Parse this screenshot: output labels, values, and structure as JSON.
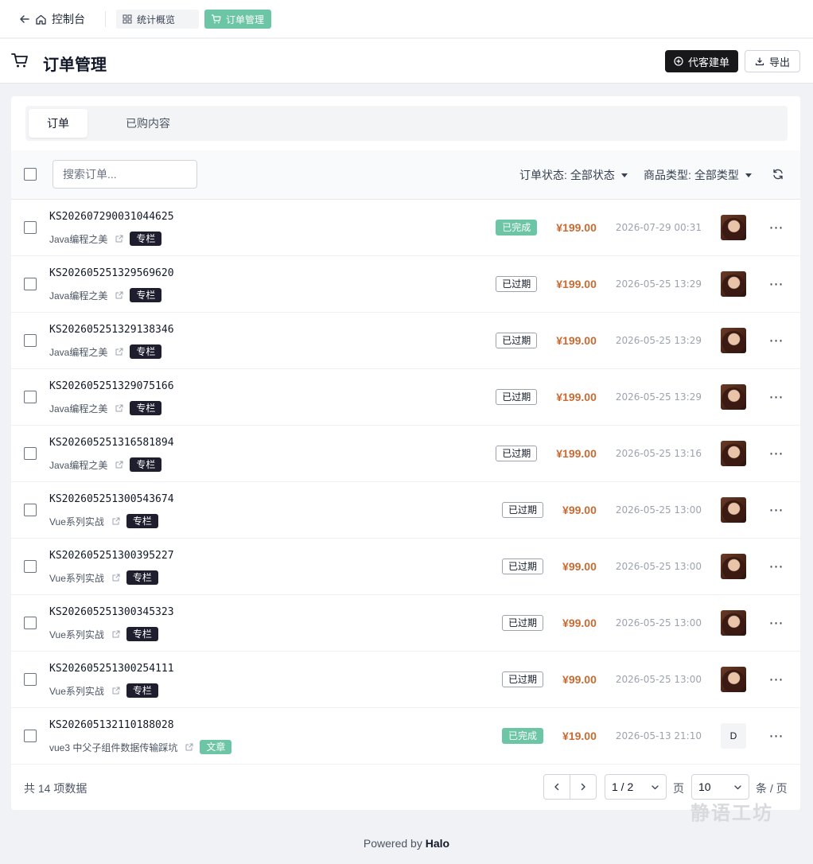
{
  "topbar": {
    "back_label": "控制台",
    "tabs": [
      {
        "label": "统计概览",
        "active": false
      },
      {
        "label": "订单管理",
        "active": true
      }
    ]
  },
  "header": {
    "title": "订单管理",
    "create_button": "代客建单",
    "export_button": "导出"
  },
  "tabs": [
    {
      "label": "订单",
      "active": true
    },
    {
      "label": "已购内容",
      "active": false
    }
  ],
  "toolbar": {
    "search_placeholder": "搜索订单...",
    "status_filter_label": "订单状态:",
    "status_filter_value": "全部状态",
    "type_filter_label": "商品类型:",
    "type_filter_value": "全部类型"
  },
  "orders": [
    {
      "order_no": "KS202607290031044625",
      "product": "Java编程之美",
      "type": "专栏",
      "type_style": "dark",
      "status": "已完成",
      "status_style": "done",
      "price": "¥199.00",
      "time": "2026-07-29 00:31",
      "avatar": "photo"
    },
    {
      "order_no": "KS202605251329569620",
      "product": "Java编程之美",
      "type": "专栏",
      "type_style": "dark",
      "status": "已过期",
      "status_style": "exp",
      "price": "¥199.00",
      "time": "2026-05-25 13:29",
      "avatar": "photo"
    },
    {
      "order_no": "KS202605251329138346",
      "product": "Java编程之美",
      "type": "专栏",
      "type_style": "dark",
      "status": "已过期",
      "status_style": "exp",
      "price": "¥199.00",
      "time": "2026-05-25 13:29",
      "avatar": "photo"
    },
    {
      "order_no": "KS202605251329075166",
      "product": "Java编程之美",
      "type": "专栏",
      "type_style": "dark",
      "status": "已过期",
      "status_style": "exp",
      "price": "¥199.00",
      "time": "2026-05-25 13:29",
      "avatar": "photo"
    },
    {
      "order_no": "KS202605251316581894",
      "product": "Java编程之美",
      "type": "专栏",
      "type_style": "dark",
      "status": "已过期",
      "status_style": "exp",
      "price": "¥199.00",
      "time": "2026-05-25 13:16",
      "avatar": "photo"
    },
    {
      "order_no": "KS202605251300543674",
      "product": "Vue系列实战",
      "type": "专栏",
      "type_style": "dark",
      "status": "已过期",
      "status_style": "exp",
      "price": "¥99.00",
      "time": "2026-05-25 13:00",
      "avatar": "photo"
    },
    {
      "order_no": "KS202605251300395227",
      "product": "Vue系列实战",
      "type": "专栏",
      "type_style": "dark",
      "status": "已过期",
      "status_style": "exp",
      "price": "¥99.00",
      "time": "2026-05-25 13:00",
      "avatar": "photo"
    },
    {
      "order_no": "KS202605251300345323",
      "product": "Vue系列实战",
      "type": "专栏",
      "type_style": "dark",
      "status": "已过期",
      "status_style": "exp",
      "price": "¥99.00",
      "time": "2026-05-25 13:00",
      "avatar": "photo"
    },
    {
      "order_no": "KS202605251300254111",
      "product": "Vue系列实战",
      "type": "专栏",
      "type_style": "dark",
      "status": "已过期",
      "status_style": "exp",
      "price": "¥99.00",
      "time": "2026-05-25 13:00",
      "avatar": "photo"
    },
    {
      "order_no": "KS202605132110188028",
      "product": "vue3 中父子组件数据传输踩坑",
      "type": "文章",
      "type_style": "green",
      "status": "已完成",
      "status_style": "done",
      "price": "¥19.00",
      "time": "2026-05-13 21:10",
      "avatar": "D"
    }
  ],
  "pagination": {
    "total_text": "共 14 项数据",
    "page_value": "1 / 2",
    "page_unit": "页",
    "size_value": "10",
    "size_unit": "条 / 页"
  },
  "watermark": "静语工坊",
  "footer": {
    "prefix": "Powered by ",
    "brand": "Halo"
  },
  "colors": {
    "accent_green": "#6cc5a5",
    "price": "#c76b32",
    "dark_button": "#18181b"
  }
}
